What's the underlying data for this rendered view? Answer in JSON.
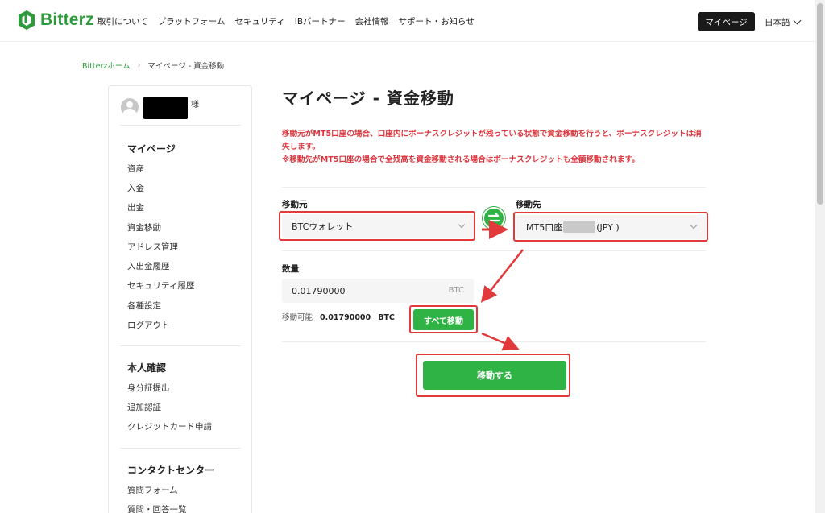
{
  "header": {
    "logo_text": "Bitterz",
    "nav": [
      "取引について",
      "プラットフォーム",
      "セキュリティ",
      "IBパートナー",
      "会社情報",
      "サポート・お知らせ"
    ],
    "mypage_button": "マイページ",
    "language": "日本語"
  },
  "breadcrumb": {
    "home": "Bitterzホーム",
    "current": "マイページ - 資金移動"
  },
  "sidebar": {
    "user_suffix": "様",
    "sections": [
      {
        "heading": "マイページ",
        "items": [
          "資産",
          "入金",
          "出金",
          "資金移動",
          "アドレス管理",
          "入出金履歴",
          "セキュリティ履歴",
          "各種設定",
          "ログアウト"
        ]
      },
      {
        "heading": "本人確認",
        "items": [
          "身分証提出",
          "追加認証",
          "クレジットカード申請"
        ]
      },
      {
        "heading": "コンタクトセンター",
        "items": [
          "質問フォーム",
          "質問・回答一覧"
        ]
      }
    ]
  },
  "main": {
    "title": "マイページ - 資金移動",
    "notice_line1": "移動元がMT5口座の場合、口座内にボーナスクレジットが残っている状態で資金移動を行うと、ボーナスクレジットは消失します。",
    "notice_line2": "※移動先がMT5口座の場合で全残高を資金移動される場合はボーナスクレジットも全額移動されます。",
    "from_label": "移動元",
    "from_value": "BTCウォレット",
    "to_label": "移動先",
    "to_value_prefix": "MT5口座",
    "to_value_suffix": "(JPY )",
    "amount_label": "数量",
    "amount_value": "0.01790000",
    "amount_unit": "BTC",
    "available_label": "移動可能",
    "available_value": "0.01790000",
    "available_unit": "BTC",
    "move_all_button": "すべて移動",
    "submit_button": "移動する"
  },
  "colors": {
    "brand_green": "#2fb344",
    "logo_green": "#2f9b3c",
    "notice_red": "#d9363e",
    "annotation_red": "#e03a3a"
  }
}
